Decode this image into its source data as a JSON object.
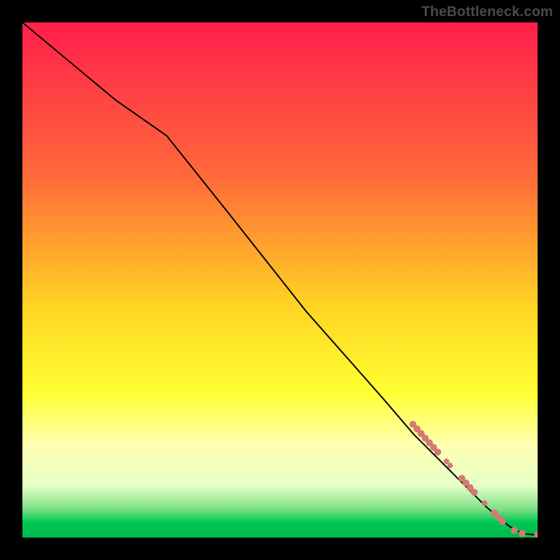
{
  "attribution": "TheBottleneck.com",
  "chart_data": {
    "type": "line",
    "title": "",
    "xlabel": "",
    "ylabel": "",
    "xlim": [
      0,
      100
    ],
    "ylim": [
      0,
      100
    ],
    "grid": false,
    "legend": false,
    "background_gradient": {
      "stops": [
        {
          "offset": 0.0,
          "color": "#ff1f4b"
        },
        {
          "offset": 0.3,
          "color": "#ff6a3a"
        },
        {
          "offset": 0.55,
          "color": "#ffd423"
        },
        {
          "offset": 0.72,
          "color": "#ffff33"
        },
        {
          "offset": 0.82,
          "color": "#ffffb0"
        },
        {
          "offset": 0.9,
          "color": "#e6ffc8"
        },
        {
          "offset": 0.945,
          "color": "#7be082"
        },
        {
          "offset": 0.97,
          "color": "#00c853"
        },
        {
          "offset": 1.0,
          "color": "#00b84d"
        }
      ]
    },
    "series": [
      {
        "name": "curve",
        "color": "#000000",
        "width": 2,
        "points": [
          {
            "x": 0.0,
            "y": 100.0
          },
          {
            "x": 18.0,
            "y": 85.0
          },
          {
            "x": 28.0,
            "y": 78.0
          },
          {
            "x": 40.0,
            "y": 63.0
          },
          {
            "x": 55.0,
            "y": 44.0
          },
          {
            "x": 70.0,
            "y": 27.0
          },
          {
            "x": 76.0,
            "y": 20.0
          },
          {
            "x": 84.0,
            "y": 12.0
          },
          {
            "x": 90.0,
            "y": 6.0
          },
          {
            "x": 94.5,
            "y": 2.2
          },
          {
            "x": 97.0,
            "y": 0.8
          },
          {
            "x": 100.0,
            "y": 0.5
          }
        ]
      }
    ],
    "markers": {
      "color": "#d27a76",
      "points": [
        {
          "x": 75.8,
          "y": 22.0,
          "r": 5
        },
        {
          "x": 76.6,
          "y": 21.1,
          "r": 5
        },
        {
          "x": 77.4,
          "y": 20.2,
          "r": 5
        },
        {
          "x": 78.2,
          "y": 19.3,
          "r": 5
        },
        {
          "x": 79.0,
          "y": 18.4,
          "r": 5
        },
        {
          "x": 79.8,
          "y": 17.5,
          "r": 5
        },
        {
          "x": 80.6,
          "y": 16.6,
          "r": 5
        },
        {
          "x": 82.3,
          "y": 14.8,
          "r": 4
        },
        {
          "x": 83.0,
          "y": 14.0,
          "r": 4
        },
        {
          "x": 85.3,
          "y": 11.5,
          "r": 5
        },
        {
          "x": 86.1,
          "y": 10.6,
          "r": 5
        },
        {
          "x": 86.9,
          "y": 9.7,
          "r": 5
        },
        {
          "x": 87.7,
          "y": 8.8,
          "r": 5
        },
        {
          "x": 89.7,
          "y": 6.7,
          "r": 4
        },
        {
          "x": 91.6,
          "y": 4.8,
          "r": 5
        },
        {
          "x": 92.4,
          "y": 3.9,
          "r": 5
        },
        {
          "x": 93.2,
          "y": 3.1,
          "r": 5
        },
        {
          "x": 95.5,
          "y": 1.4,
          "r": 5
        },
        {
          "x": 97.0,
          "y": 0.8,
          "r": 5
        },
        {
          "x": 100.0,
          "y": 0.6,
          "r": 5
        }
      ]
    }
  }
}
